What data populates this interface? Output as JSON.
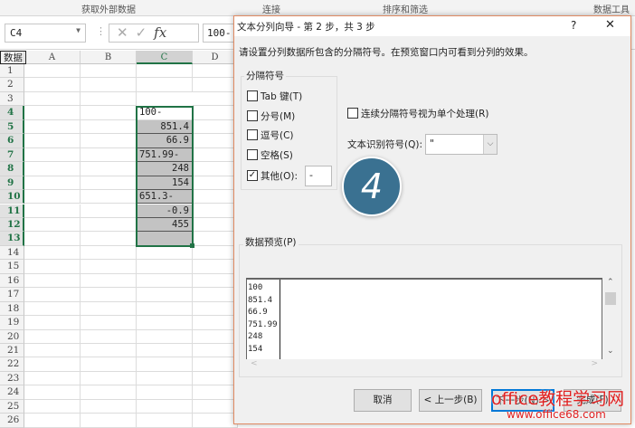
{
  "ribbon": {
    "groups": [
      "获取外部数据",
      "连接",
      "排序和筛选",
      "数据工具"
    ]
  },
  "formula_bar": {
    "name_box": "C4",
    "fx_label": "fx",
    "value": "100-"
  },
  "sheet": {
    "columns": [
      "A",
      "B",
      "C",
      "D"
    ],
    "rows": [
      "1",
      "2",
      "3",
      "4",
      "5",
      "6",
      "7",
      "8",
      "9",
      "10",
      "11",
      "12",
      "13",
      "14",
      "15",
      "16",
      "17",
      "18",
      "19",
      "20",
      "21",
      "22",
      "23",
      "24",
      "25",
      "26"
    ],
    "c_values": {
      "3": "数据",
      "4": "100-",
      "5": "851.4",
      "6": "66.9",
      "7": "751.99-",
      "8": "248",
      "9": "154",
      "10": "651.3-",
      "11": "-0.9",
      "12": "455"
    },
    "selected_cell": "C4"
  },
  "dialog": {
    "title": "文本分列向导 - 第 2 步，共 3 步",
    "help": "?",
    "close": "✕",
    "instruction": "请设置分列数据所包含的分隔符号。在预览窗口内可看到分列的效果。",
    "delimiters_group": "分隔符号",
    "delimiters": [
      {
        "label": "Tab 键(T)",
        "checked": false
      },
      {
        "label": "分号(M)",
        "checked": false
      },
      {
        "label": "逗号(C)",
        "checked": false
      },
      {
        "label": "空格(S)",
        "checked": false
      },
      {
        "label": "其他(O):",
        "checked": true
      }
    ],
    "other_value": "-",
    "consecutive": {
      "label": "连续分隔符号视为单个处理(R)",
      "checked": false
    },
    "qualifier_label": "文本识别符号(Q):",
    "qualifier_value": "\"",
    "step_badge": "4",
    "preview_label": "数据预览(P)",
    "preview_rows": [
      "100",
      "851.4",
      "66.9",
      "751.99",
      "248",
      "154"
    ],
    "buttons": {
      "cancel": "取消",
      "back": "< 上一步(B)",
      "next": "下一步(N) >",
      "finish": "完成(F)"
    }
  },
  "watermark": {
    "line1": "office教程学习网",
    "line2": "www.office68.com"
  },
  "colors": {
    "accent": "#217346",
    "badge": "#3a7191",
    "dialog_border": "#e08a62",
    "watermark": "#e02020"
  }
}
